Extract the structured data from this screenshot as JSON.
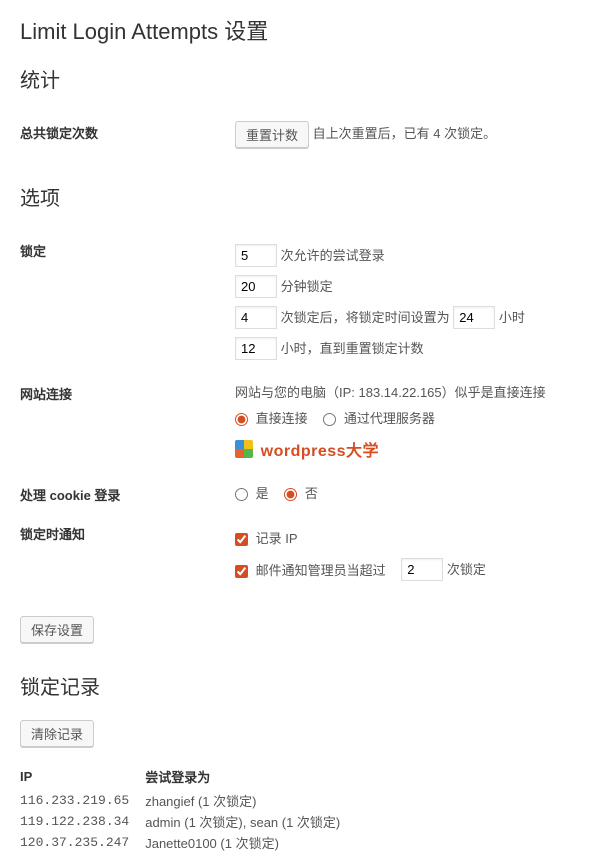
{
  "page_title": "Limit Login Attempts 设置",
  "stats": {
    "heading": "统计",
    "total_lockouts_label": "总共锁定次数",
    "reset_button": "重置计数",
    "since_reset_text": "自上次重置后，已有 4 次锁定。"
  },
  "options": {
    "heading": "选项",
    "lockout": {
      "label": "锁定",
      "allowed_retries_value": "5",
      "allowed_retries_suffix": "次允许的尝试登录",
      "lockout_minutes_value": "20",
      "lockout_minutes_suffix": "分钟锁定",
      "long_threshold_value": "4",
      "long_threshold_mid": "次锁定后，将锁定时间设置为",
      "long_hours_value": "24",
      "long_hours_suffix": "小时",
      "reset_hours_value": "12",
      "reset_hours_suffix": "小时，直到重置锁定计数"
    },
    "site_connection": {
      "label": "网站连接",
      "info": "网站与您的电脑（IP: 183.14.22.165）似乎是直接连接",
      "direct_label": "直接连接",
      "proxy_label": "通过代理服务器"
    },
    "watermark": {
      "text": "wordpress大学"
    },
    "cookie": {
      "label": "处理 cookie 登录",
      "yes": "是",
      "no": "否"
    },
    "notify": {
      "label": "锁定时通知",
      "log_ip": "记录 IP",
      "email_prefix": "邮件通知管理员当超过",
      "email_value": "2",
      "email_suffix": "次锁定"
    },
    "save_button": "保存设置"
  },
  "log": {
    "heading": "锁定记录",
    "clear_button": "清除记录",
    "col_ip": "IP",
    "col_attempt": "尝试登录为",
    "rows": [
      {
        "ip": "116.233.219.65",
        "attempt": "zhangief (1 次锁定)"
      },
      {
        "ip": "119.122.238.34",
        "attempt": "admin (1 次锁定), sean (1 次锁定)"
      },
      {
        "ip": "120.37.235.247",
        "attempt": "Janette0100 (1 次锁定)"
      }
    ]
  }
}
